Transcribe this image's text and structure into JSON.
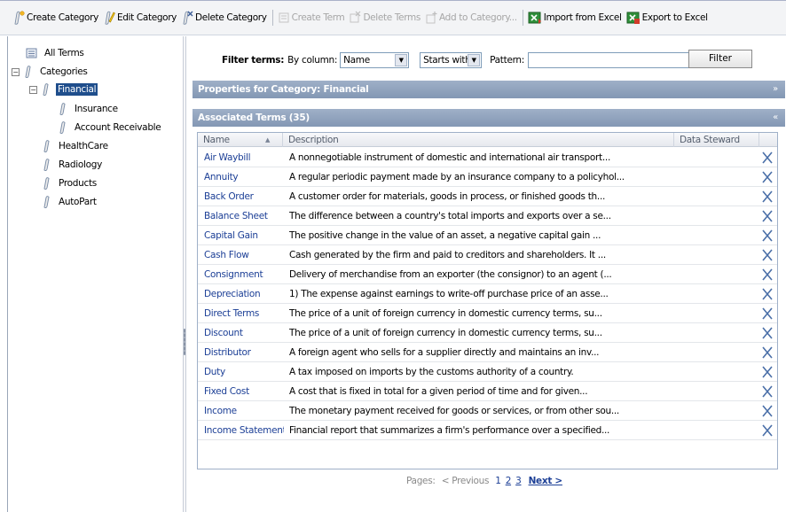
{
  "toolbar": {
    "create_category": "Create Category",
    "edit_category": "Edit Category",
    "delete_category": "Delete Category",
    "create_term": "Create Term",
    "delete_terms": "Delete Terms",
    "add_to_category": "Add to Category...",
    "import_excel": "Import from Excel",
    "export_excel": "Export to Excel"
  },
  "tree": {
    "all_terms": "All Terms",
    "categories": "Categories",
    "financial": "Financial",
    "insurance": "Insurance",
    "account_receivable": "Account Receivable",
    "healthcare": "HealthCare",
    "radiology": "Radiology",
    "products": "Products",
    "autopart": "AutoPart"
  },
  "filter": {
    "label": "Filter terms:",
    "by_column": "By column:",
    "column_value": "Name",
    "match_value": "Starts with",
    "pattern_label": "Pattern:",
    "pattern_value": "",
    "button": "Filter"
  },
  "properties_panel": {
    "title": "Properties for Category: Financial",
    "chevron": "»"
  },
  "terms_panel": {
    "title": "Associated Terms (35)",
    "chevron": "«"
  },
  "table": {
    "columns": {
      "name": "Name",
      "description": "Description",
      "steward": "Data Steward"
    },
    "rows": [
      {
        "name": "Air Waybill",
        "description": "A nonnegotiable instrument of domestic and international air transport..."
      },
      {
        "name": "Annuity",
        "description": "A regular periodic payment made by an insurance company to a policyhol..."
      },
      {
        "name": "Back Order",
        "description": "A customer order for materials, goods in process, or finished goods th..."
      },
      {
        "name": "Balance Sheet",
        "description": "The difference between a country's total imports and exports over a se..."
      },
      {
        "name": "Capital Gain",
        "description": "The positive change in the value of an asset, a negative capital gain ..."
      },
      {
        "name": "Cash Flow",
        "description": "Cash generated by the firm and paid to creditors and shareholders. It ..."
      },
      {
        "name": "Consignment",
        "description": "Delivery of merchandise from an exporter (the consignor) to an agent (..."
      },
      {
        "name": "Depreciation",
        "description": "1) The expense against earnings to write-off purchase price of an asse..."
      },
      {
        "name": "Direct Terms",
        "description": "The price of a unit of foreign currency in domestic currency terms, su..."
      },
      {
        "name": "Discount",
        "description": "The price of a unit of foreign currency in domestic currency terms, su..."
      },
      {
        "name": "Distributor",
        "description": "A foreign agent who sells for a supplier directly and maintains an inv..."
      },
      {
        "name": "Duty",
        "description": "A tax imposed on imports by the customs authority of a country."
      },
      {
        "name": "Fixed Cost",
        "description": "A cost that is fixed in total for a given period of time and for given..."
      },
      {
        "name": "Income",
        "description": "The monetary payment received for goods or services, or from other sou..."
      },
      {
        "name": "Income Statement",
        "description": "Financial report that summarizes a firm's performance over a specified..."
      }
    ]
  },
  "pager": {
    "label": "Pages:",
    "previous": "< Previous",
    "page1": "1",
    "page2": "2",
    "page3": "3",
    "next": "Next >"
  },
  "colors": {
    "link": "#1c3f96",
    "panel_header": "#8ea0bc",
    "selected": "#1f4e8c",
    "delete_x": "#4a6fa8"
  }
}
